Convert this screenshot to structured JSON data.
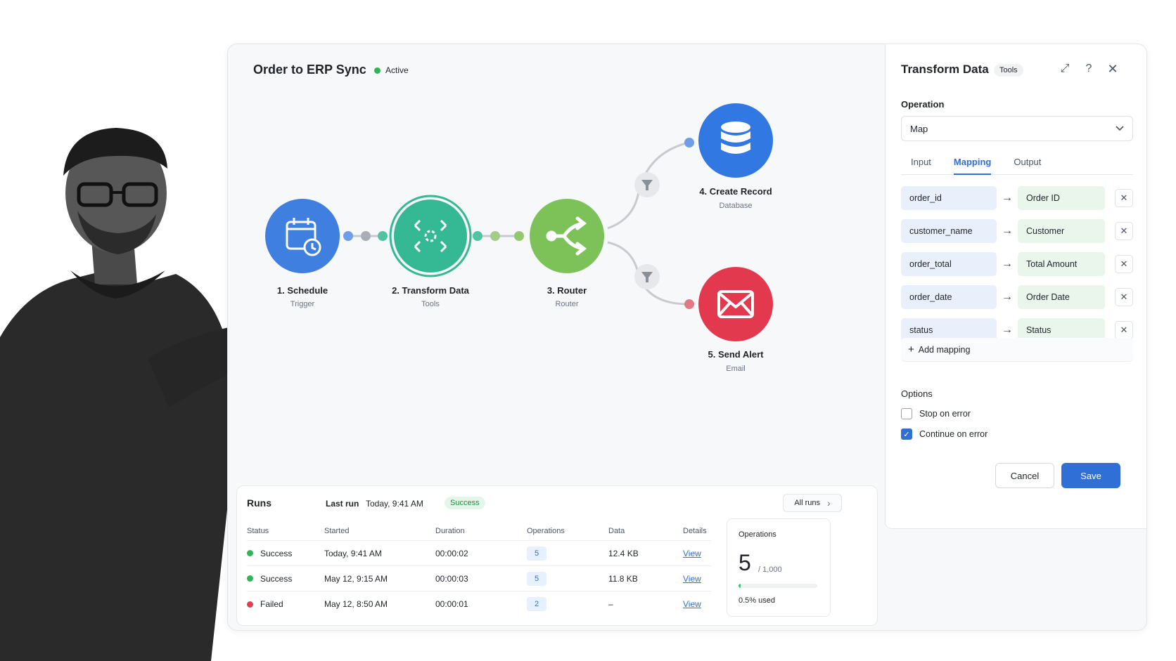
{
  "scenario": {
    "title": "Order to ERP Sync",
    "status": "Active"
  },
  "colors": {
    "schedule": "#3f7fe0",
    "transform": "#35b894",
    "router": "#7cc259",
    "database": "#3278e2",
    "email": "#e2394f",
    "active": "#2fb457",
    "failed": "#e0404c"
  },
  "nodes": [
    {
      "label": "1. Schedule",
      "sub": "Trigger",
      "icon": "calendar-clock-icon"
    },
    {
      "label": "2. Transform Data",
      "sub": "Tools",
      "icon": "transform-icon"
    },
    {
      "label": "3. Router",
      "sub": "Router",
      "icon": "router-branch-icon"
    },
    {
      "label": "4. Create Record",
      "sub": "Database",
      "icon": "database-icon"
    },
    {
      "label": "5. Send Alert",
      "sub": "Email",
      "icon": "envelope-icon"
    }
  ],
  "runs": {
    "title": "Runs",
    "last_run_label": "Last run",
    "last_run_value": "Today, 9:41 AM",
    "last_run_status": "Success",
    "all_runs": "All runs",
    "columns": [
      "Status",
      "Started",
      "Duration",
      "Operations",
      "Data",
      "Details"
    ],
    "rows": [
      {
        "status": "Success",
        "started": "Today, 9:41 AM",
        "duration": "00:00:02",
        "ops": "5",
        "data": "12.4 KB",
        "details": "View"
      },
      {
        "status": "Success",
        "started": "May 12, 9:15 AM",
        "duration": "00:00:03",
        "ops": "5",
        "data": "11.8 KB",
        "details": "View"
      },
      {
        "status": "Failed",
        "started": "May 12, 8:50 AM",
        "duration": "00:00:01",
        "ops": "2",
        "data": "–",
        "details": "View"
      }
    ],
    "operations_card": {
      "title": "Operations",
      "used": "5",
      "limit": "/ 1,000",
      "fraction": 0.005,
      "used_text": "0.5% used"
    }
  },
  "panel": {
    "title": "Transform Data",
    "tag": "Tools",
    "operation_label": "Operation",
    "operation_value": "Map",
    "tabs": [
      "Input",
      "Mapping",
      "Output"
    ],
    "active_tab": "Mapping",
    "mappings": [
      {
        "source": "order_id",
        "target": "Order ID"
      },
      {
        "source": "customer_name",
        "target": "Customer"
      },
      {
        "source": "order_total",
        "target": "Total Amount"
      },
      {
        "source": "order_date",
        "target": "Order Date"
      },
      {
        "source": "status",
        "target": "Status"
      }
    ],
    "add_mapping": "Add mapping",
    "options_label": "Options",
    "options": [
      {
        "label": "Stop on error",
        "checked": false
      },
      {
        "label": "Continue on error",
        "checked": true
      }
    ],
    "cancel": "Cancel",
    "save": "Save"
  }
}
